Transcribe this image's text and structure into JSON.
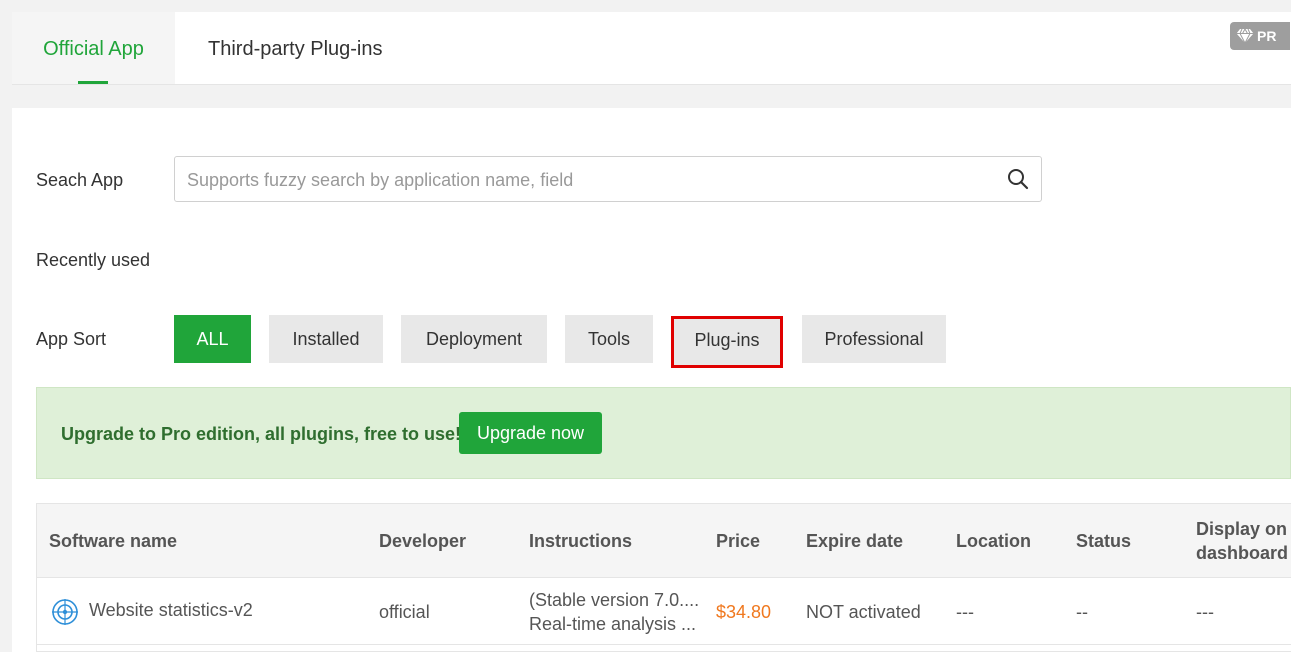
{
  "tabs": [
    {
      "label": "Official App",
      "active": true
    },
    {
      "label": "Third-party Plug-ins",
      "active": false
    }
  ],
  "pro_badge": {
    "label": "PR"
  },
  "search": {
    "label": "Seach App",
    "placeholder": "Supports fuzzy search by application name, field",
    "value": ""
  },
  "recently_used": {
    "label": "Recently used"
  },
  "app_sort": {
    "label": "App Sort",
    "options": [
      "ALL",
      "Installed",
      "Deployment",
      "Tools",
      "Plug-ins",
      "Professional"
    ],
    "selected": "ALL",
    "highlighted": "Plug-ins"
  },
  "upgrade": {
    "text": "Upgrade to Pro edition, all plugins, free to use!",
    "button": "Upgrade now"
  },
  "table": {
    "headers": {
      "software_name": "Software name",
      "developer": "Developer",
      "instructions": "Instructions",
      "price": "Price",
      "expire_date": "Expire date",
      "location": "Location",
      "status": "Status",
      "display_line1": "Display on",
      "display_line2": "dashboard"
    },
    "rows": [
      {
        "name": "Website statistics-v2",
        "developer": "official",
        "instructions_line1": "(Stable version 7.0....",
        "instructions_line2": "Real-time analysis ...",
        "price": "$34.80",
        "expire": "NOT activated",
        "location": "---",
        "status": "--",
        "display": "---"
      }
    ]
  },
  "colors": {
    "accent": "#20a53a",
    "price": "#f0781e",
    "highlight_border": "#e00000",
    "upgrade_bg": "#dff0d8"
  }
}
